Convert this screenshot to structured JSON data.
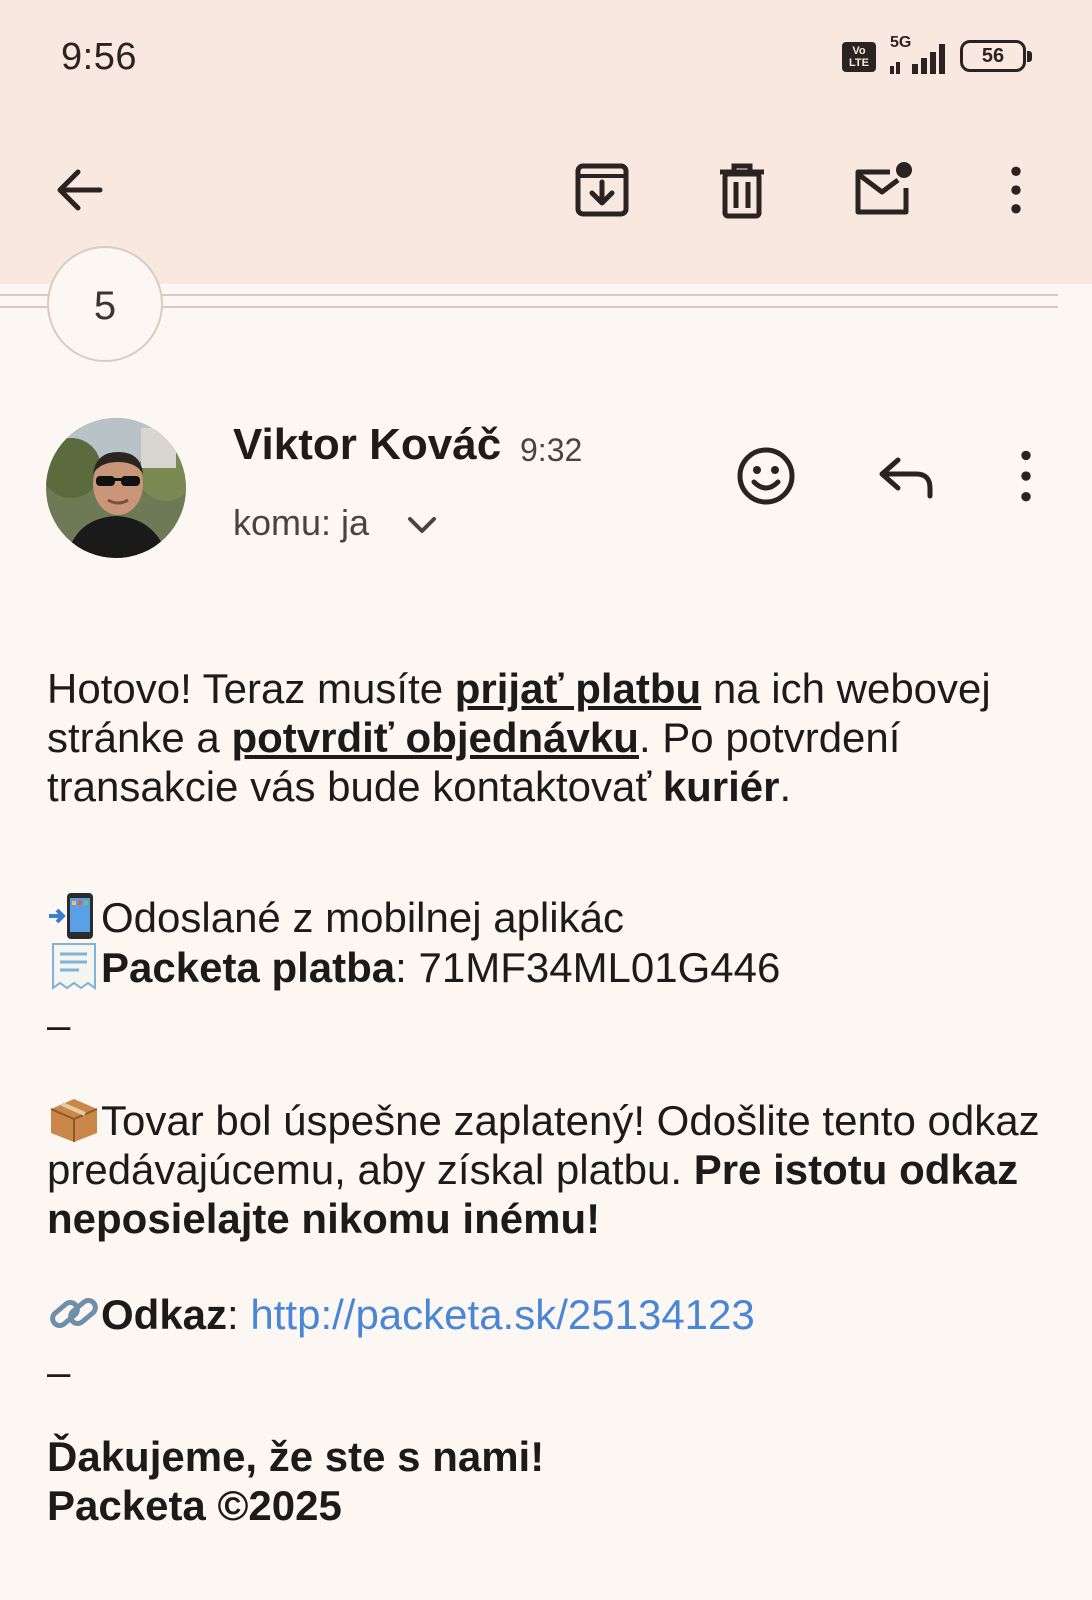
{
  "status_bar": {
    "time": "9:56",
    "network": "5G",
    "volte": "Vo LTE",
    "battery": "56"
  },
  "toolbar": {
    "icons": [
      "back-arrow-icon",
      "archive-icon",
      "trash-icon",
      "mark-unread-icon",
      "more-vert-icon"
    ]
  },
  "thread": {
    "collapsed_count": "5"
  },
  "message": {
    "sender": "Viktor Kováč",
    "time": "9:32",
    "recipient": "komu: ja",
    "body": {
      "p1_a": "Hotovo! Teraz musíte ",
      "p1_link1": "prijať platbu",
      "p1_b": " na ich webovej stránke a ",
      "p1_link2": "potvrdiť objednávku",
      "p1_c": ". Po potvrdení transakcie vás bude kontaktovať ",
      "p1_bold": "kuriér",
      "p1_d": ".",
      "sent_from": "Odoslané z mobilnej aplikác",
      "payment_label": "Packeta platba",
      "payment_sep": ": ",
      "payment_code": "71MF34ML01G446",
      "dash1": "–",
      "paid_a": "Tovar bol úspešne zaplatený! Odošlite tento odkaz predávajúcemu, aby získal platbu. ",
      "paid_bold": "Pre istotu odkaz neposielajte nikomu inému!",
      "link_label": "Odkaz",
      "link_sep": ": ",
      "link_url": "http://packeta.sk/25134123",
      "dash2": "–",
      "thanks": "Ďakujeme, že ste s nami!",
      "signature": "Packeta ©2025"
    }
  },
  "colors": {
    "header_bg": "#f9e8df",
    "page_bg": "#fcf7f3",
    "link": "#4a86d6"
  }
}
